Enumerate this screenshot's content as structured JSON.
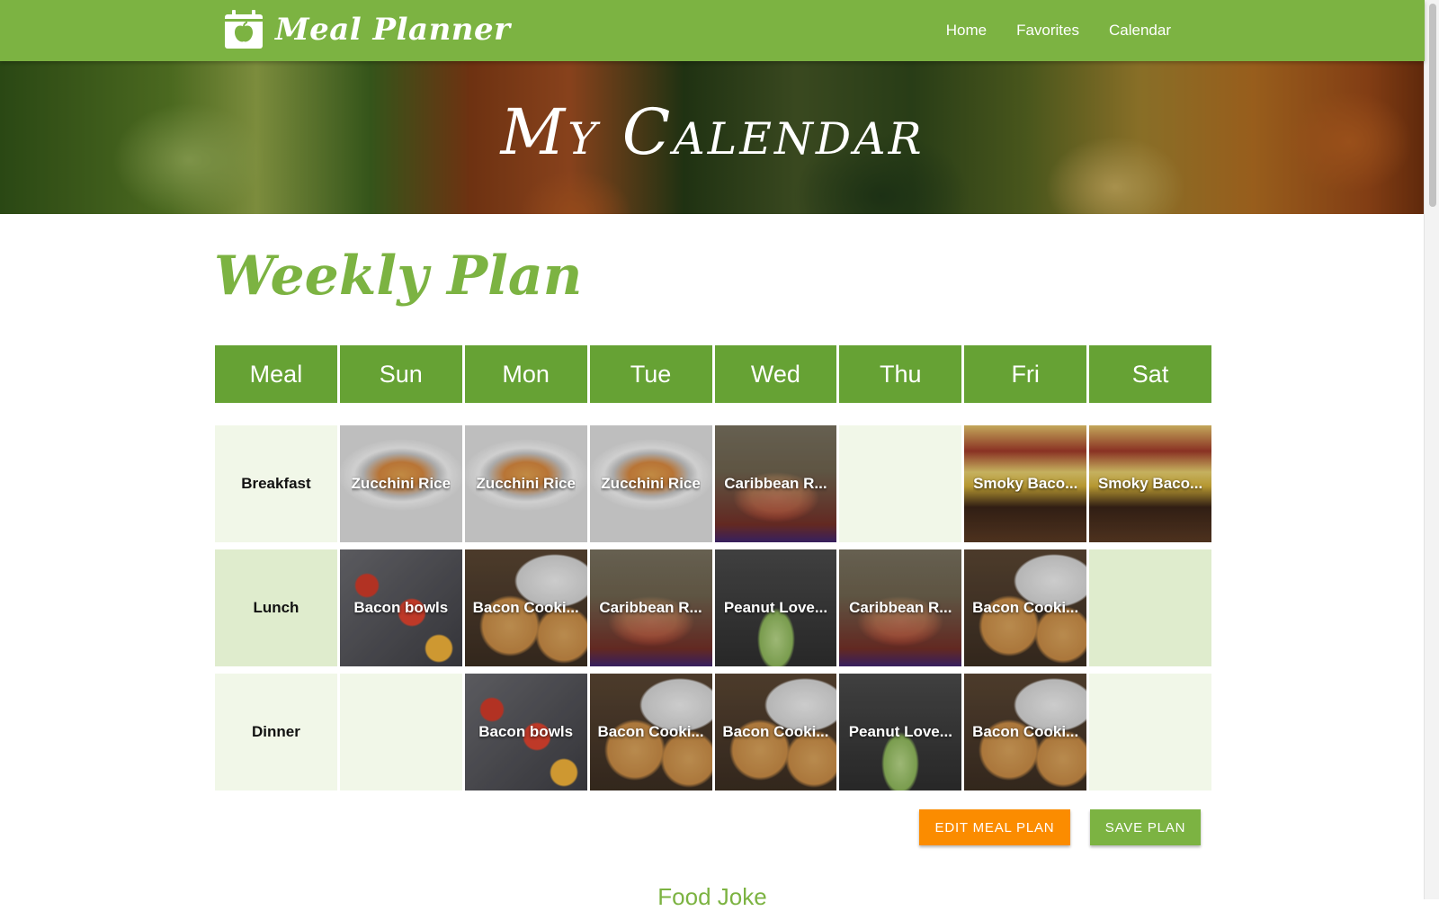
{
  "navbar": {
    "brand": "Meal Planner",
    "brand_icon": "calendar-apple-icon",
    "links": [
      "Home",
      "Favorites",
      "Calendar"
    ],
    "color": "#7cb342"
  },
  "hero": {
    "title": "My Calendar"
  },
  "section": {
    "title": "Weekly Plan"
  },
  "table": {
    "headers": [
      "Meal",
      "Sun",
      "Mon",
      "Tue",
      "Wed",
      "Thu",
      "Fri",
      "Sat"
    ],
    "rows": [
      {
        "meal": "Breakfast",
        "cells": [
          "Zucchini Rice",
          "Zucchini Rice",
          "Zucchini Rice",
          "Caribbean R...",
          "",
          "Smoky Baco...",
          "Smoky Baco..."
        ]
      },
      {
        "meal": "Lunch",
        "cells": [
          "Bacon bowls",
          "Bacon Cooki...",
          "Caribbean R...",
          "Peanut Love...",
          "Caribbean R...",
          "Bacon Cooki...",
          ""
        ]
      },
      {
        "meal": "Dinner",
        "cells": [
          "",
          "Bacon bowls",
          "Bacon Cooki...",
          "Bacon Cooki...",
          "Peanut Love...",
          "Bacon Cooki...",
          ""
        ]
      }
    ]
  },
  "buttons": {
    "edit": "EDIT MEAL PLAN",
    "save": "SAVE PLAN"
  },
  "footer": {
    "heading": "Food Joke"
  },
  "colors": {
    "accent": "#7cb342",
    "header_cell": "#66a234",
    "edit_button": "#fb8c00"
  }
}
